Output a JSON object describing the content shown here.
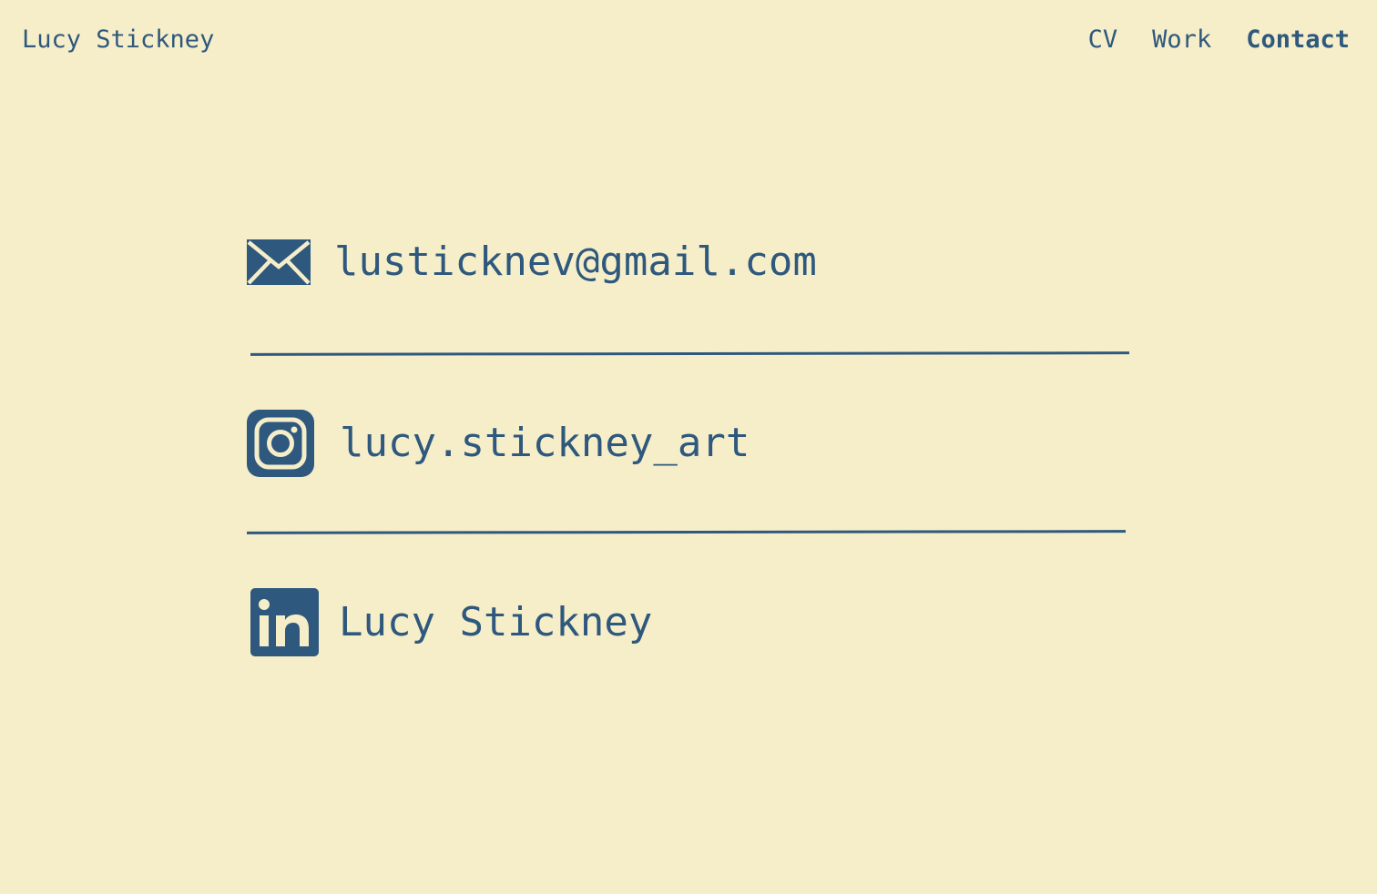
{
  "header": {
    "site_title": "Lucy Stickney",
    "nav": [
      {
        "label": "CV",
        "active": false
      },
      {
        "label": "Work",
        "active": false
      },
      {
        "label": "Contact",
        "active": true
      }
    ]
  },
  "contacts": {
    "email": {
      "icon": "envelope-icon",
      "label": "lusticknev@gmail.com"
    },
    "instagram": {
      "icon": "instagram-icon",
      "label": "lucy.stickney_art"
    },
    "linkedin": {
      "icon": "linkedin-icon",
      "label": "Lucy Stickney"
    }
  },
  "colors": {
    "background": "#f6eec9",
    "accent": "#2e587d"
  }
}
